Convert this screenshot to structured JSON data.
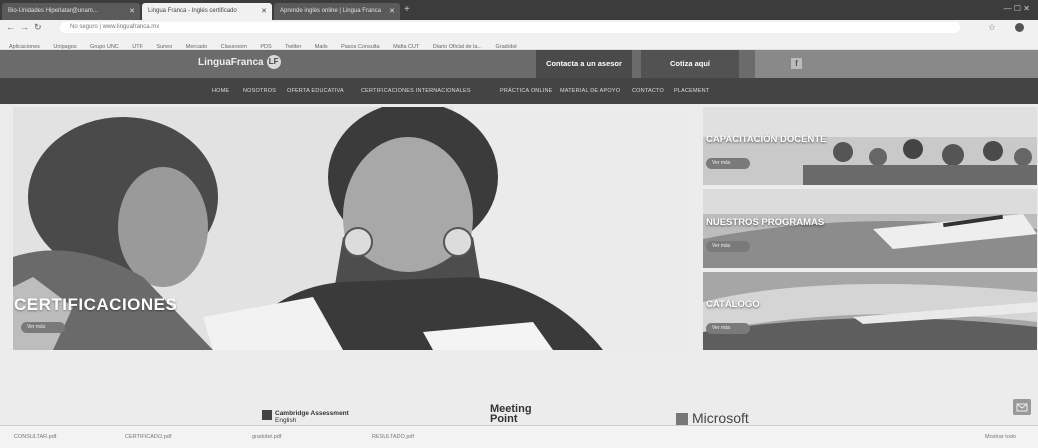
{
  "browser": {
    "tabs": [
      {
        "title": "Bio-Unidades Hiperlatar@unam...",
        "active": false
      },
      {
        "title": "Lingua Franca - Inglés certificado",
        "active": true
      },
      {
        "title": "Aprende inglés online | Lingua Franca",
        "active": false
      }
    ],
    "new_tab": "+",
    "window_controls": "—  ☐  ✕",
    "url": "No seguro | www.linguafranca.mx",
    "bookmarks": [
      "Aplicaciones",
      "Unipagos",
      "Grupo UNC",
      "UTF",
      "Suneo",
      "Mercado",
      "Classroom",
      "PDS",
      "Twitter",
      "Mails",
      "Pasos Consulta",
      "Mafia CUT",
      "Diario Oficial de la...",
      "Gradobé"
    ]
  },
  "site": {
    "logo_text": "LinguaFranca",
    "logo_badge": "LF",
    "cta_asesor": "Contacta a un asesor",
    "cta_cotiza": "Cotiza aquí",
    "facebook_icon": "f",
    "nav": [
      "HOME",
      "NOSOTROS",
      "OFERTA EDUCATIVA",
      "CERTIFICACIONES INTERNACIONALES",
      "PRÁCTICA ONLINE",
      "MATERIAL DE APOYO",
      "CONTACTO",
      "PLACEMENT"
    ]
  },
  "hero": {
    "title": "CERTIFICACIONES",
    "button": "Ver más"
  },
  "side_cards": [
    {
      "title": "CAPACITACIÓN DOCENTE",
      "button": "Ver más"
    },
    {
      "title": "NUESTROS PROGRAMAS",
      "button": "Ver más"
    },
    {
      "title": "CATÁLOGO",
      "button": "Ver más"
    }
  ],
  "partners": {
    "cambridge_line1": "Cambridge Assessment",
    "cambridge_line2": "English",
    "meeting_line1": "Meeting",
    "meeting_line2": "Point",
    "microsoft": "Microsoft"
  },
  "downloads": [
    "CONSULTAR.pdf",
    "CERTIFICADO.pdf",
    "gradobé.pdf",
    "RESULTADO.pdf"
  ],
  "downloads_show_all": "Mostrar todo"
}
